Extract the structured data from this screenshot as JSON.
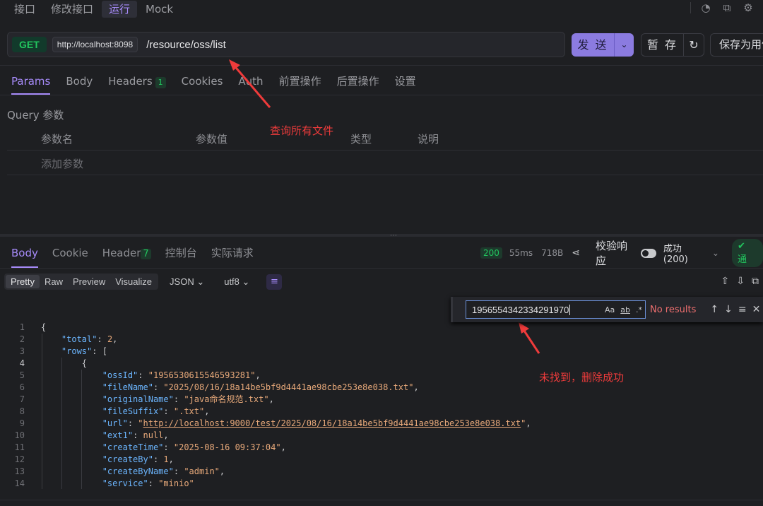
{
  "top_tabs": [
    "接口",
    "修改接口",
    "运行",
    "Mock"
  ],
  "request": {
    "method": "GET",
    "host": "http://localhost:8098",
    "path": "/resource/oss/list",
    "send_label": "发 送",
    "save_label": "暂 存",
    "save_as_label": "保存为用例"
  },
  "request_tabs": [
    {
      "label": "Params",
      "badge": ""
    },
    {
      "label": "Body",
      "badge": ""
    },
    {
      "label": "Headers",
      "badge": "1"
    },
    {
      "label": "Cookies",
      "badge": ""
    },
    {
      "label": "Auth",
      "badge": ""
    },
    {
      "label": "前置操作",
      "badge": ""
    },
    {
      "label": "后置操作",
      "badge": ""
    },
    {
      "label": "设置",
      "badge": ""
    }
  ],
  "query": {
    "title": "Query 参数",
    "headers": [
      "参数名",
      "参数值",
      "类型",
      "说明"
    ],
    "add_placeholder": "添加参数"
  },
  "annotations": {
    "query_note": "查询所有文件",
    "find_note": "未找到，删除成功"
  },
  "response_tabs": [
    {
      "label": "Body",
      "badge": ""
    },
    {
      "label": "Cookie",
      "badge": ""
    },
    {
      "label": "Header",
      "badge": "7"
    },
    {
      "label": "控制台",
      "badge": ""
    },
    {
      "label": "实际请求",
      "badge": ""
    }
  ],
  "response_status": {
    "code": "200",
    "time": "55ms",
    "size": "718B",
    "verify_label": "校验响应",
    "success_label": "成功 (200)",
    "pass_label": "通"
  },
  "format_tabs": [
    "Pretty",
    "Raw",
    "Preview",
    "Visualize"
  ],
  "format_select": "JSON",
  "encoding_select": "utf8",
  "find": {
    "query": "1956554342334291970",
    "opts": [
      "Aa",
      "ab",
      ".*"
    ],
    "result": "No results"
  },
  "code_lines": [
    "{",
    "    \"total\": 2,",
    "    \"rows\": [",
    "        {",
    "            \"ossId\": \"1956530615546593281\",",
    "            \"fileName\": \"2025/08/16/18a14be5bf9d4441ae98cbe253e8e038.txt\",",
    "            \"originalName\": \"java命名规范.txt\",",
    "            \"fileSuffix\": \".txt\",",
    "            \"url\": \"http://localhost:9000/test/2025/08/16/18a14be5bf9d4441ae98cbe253e8e038.txt\",",
    "            \"ext1\": null,",
    "            \"createTime\": \"2025-08-16 09:37:04\",",
    "            \"createBy\": 1,",
    "            \"createByName\": \"admin\",",
    "            \"service\": \"minio\""
  ],
  "colors": {
    "accent": "#a78bfa",
    "success": "#22c55e",
    "annotation": "#ef3b3b",
    "json_key": "#6cb6ff",
    "json_value": "#e8a97a"
  }
}
